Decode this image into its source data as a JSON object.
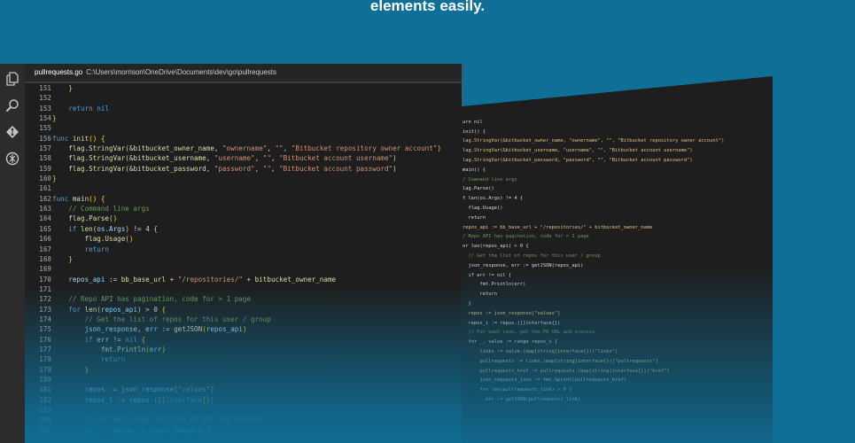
{
  "headline": "elements easily.",
  "activity_icons": [
    "files-icon",
    "search-icon",
    "git-icon",
    "debug-icon"
  ],
  "editor": {
    "tab_name": "pullrequests.go",
    "tab_path": "C:\\Users\\morrison\\OneDrive\\Documents\\dev\\go\\pullrequests",
    "lines": [
      {
        "n": "151",
        "t": [
          [
            "br",
            "    }"
          ]
        ]
      },
      {
        "n": "152",
        "t": []
      },
      {
        "n": "153",
        "t": [
          [
            "kw",
            "    return "
          ],
          [
            "kw",
            "nil"
          ]
        ]
      },
      {
        "n": "154",
        "t": [
          [
            "br",
            "}"
          ]
        ]
      },
      {
        "n": "155",
        "t": []
      },
      {
        "n": "156",
        "t": [
          [
            "kw",
            "func "
          ],
          [
            "fn",
            "init"
          ],
          [
            "br",
            "() {"
          ]
        ]
      },
      {
        "n": "157",
        "t": [
          [
            "fn",
            "    flag.StringVar"
          ],
          [
            "br",
            "("
          ],
          [
            "op",
            "&"
          ],
          [
            "fn",
            "bitbucket_owner_name"
          ],
          [
            "op",
            ", "
          ],
          [
            "str",
            "\"ownername\""
          ],
          [
            "op",
            ", "
          ],
          [
            "str",
            "\"\""
          ],
          [
            "op",
            ", "
          ],
          [
            "str",
            "\"Bitbucket repository owner account\""
          ],
          [
            "br",
            ")"
          ]
        ]
      },
      {
        "n": "158",
        "t": [
          [
            "fn",
            "    flag.StringVar"
          ],
          [
            "br",
            "("
          ],
          [
            "op",
            "&"
          ],
          [
            "fn",
            "bitbucket_username"
          ],
          [
            "op",
            ", "
          ],
          [
            "str",
            "\"username\""
          ],
          [
            "op",
            ", "
          ],
          [
            "str",
            "\"\""
          ],
          [
            "op",
            ", "
          ],
          [
            "str",
            "\"Bitbucket account username\""
          ],
          [
            "br",
            ")"
          ]
        ]
      },
      {
        "n": "159",
        "t": [
          [
            "fn",
            "    flag.StringVar"
          ],
          [
            "br",
            "("
          ],
          [
            "op",
            "&"
          ],
          [
            "fn",
            "bitbucket_password"
          ],
          [
            "op",
            ", "
          ],
          [
            "str",
            "\"password\""
          ],
          [
            "op",
            ", "
          ],
          [
            "str",
            "\"\""
          ],
          [
            "op",
            ", "
          ],
          [
            "str",
            "\"Bitbucket account password\""
          ],
          [
            "br",
            ")"
          ]
        ]
      },
      {
        "n": "160",
        "t": [
          [
            "br",
            "}"
          ]
        ]
      },
      {
        "n": "161",
        "t": []
      },
      {
        "n": "162",
        "t": [
          [
            "kw",
            "func "
          ],
          [
            "fn",
            "main"
          ],
          [
            "br",
            "() {"
          ]
        ]
      },
      {
        "n": "163",
        "t": [
          [
            "cm",
            "    // Command line args"
          ]
        ]
      },
      {
        "n": "164",
        "t": [
          [
            "fn",
            "    flag.Parse"
          ],
          [
            "br",
            "()"
          ]
        ]
      },
      {
        "n": "165",
        "t": [
          [
            "kw",
            "    if "
          ],
          [
            "fn",
            "len"
          ],
          [
            "br",
            "("
          ],
          [
            "var",
            "os.Args"
          ],
          [
            "br",
            ")"
          ],
          [
            "op",
            " != "
          ],
          [
            "plain",
            "4 "
          ],
          [
            "br",
            "{"
          ]
        ]
      },
      {
        "n": "166",
        "t": [
          [
            "fn",
            "        flag.Usage"
          ],
          [
            "br",
            "()"
          ]
        ]
      },
      {
        "n": "167",
        "t": [
          [
            "kw",
            "        return"
          ]
        ]
      },
      {
        "n": "168",
        "t": [
          [
            "br",
            "    }"
          ]
        ]
      },
      {
        "n": "169",
        "t": []
      },
      {
        "n": "170",
        "t": [
          [
            "var",
            "    repos_api "
          ],
          [
            "op",
            ":= "
          ],
          [
            "fn",
            "bb_base_url "
          ],
          [
            "op",
            "+ "
          ],
          [
            "str",
            "\"/repositories/\" "
          ],
          [
            "op",
            "+ "
          ],
          [
            "fn",
            "bitbucket_owner_name"
          ]
        ]
      },
      {
        "n": "171",
        "t": []
      },
      {
        "n": "172",
        "t": [
          [
            "cm",
            "    // Repo API has pagination, code for > 1 page"
          ]
        ]
      },
      {
        "n": "173",
        "t": [
          [
            "kw",
            "    for "
          ],
          [
            "fn",
            "len"
          ],
          [
            "br",
            "("
          ],
          [
            "var",
            "repos_api"
          ],
          [
            "br",
            ")"
          ],
          [
            "op",
            " > "
          ],
          [
            "plain",
            "0 "
          ],
          [
            "br",
            "{"
          ]
        ]
      },
      {
        "n": "174",
        "t": [
          [
            "cm",
            "        // Get the list of repos for this user / group"
          ]
        ]
      },
      {
        "n": "175",
        "t": [
          [
            "var",
            "        json_response"
          ],
          [
            "op",
            ", "
          ],
          [
            "var",
            "err "
          ],
          [
            "op",
            ":= "
          ],
          [
            "fn",
            "getJSON"
          ],
          [
            "br",
            "("
          ],
          [
            "var",
            "repos_api"
          ],
          [
            "br",
            ")"
          ]
        ]
      },
      {
        "n": "176",
        "t": [
          [
            "kw",
            "        if "
          ],
          [
            "var",
            "err "
          ],
          [
            "op",
            "!= "
          ],
          [
            "kw",
            "nil "
          ],
          [
            "br",
            "{"
          ]
        ]
      },
      {
        "n": "177",
        "t": [
          [
            "fn",
            "            fmt.Println"
          ],
          [
            "br",
            "("
          ],
          [
            "var",
            "err"
          ],
          [
            "br",
            ")"
          ]
        ]
      },
      {
        "n": "178",
        "t": [
          [
            "kw",
            "            return"
          ]
        ]
      },
      {
        "n": "179",
        "t": [
          [
            "br",
            "        }"
          ]
        ]
      },
      {
        "n": "180",
        "t": []
      },
      {
        "n": "181",
        "t": [
          [
            "var",
            "        repos "
          ],
          [
            "op",
            ":= "
          ],
          [
            "var",
            "json_response"
          ],
          [
            "br",
            "["
          ],
          [
            "str",
            "\"values\""
          ],
          [
            "br",
            "]"
          ]
        ]
      },
      {
        "n": "182",
        "t": [
          [
            "var",
            "        repos_i "
          ],
          [
            "op",
            ":= "
          ],
          [
            "var",
            "repos."
          ],
          [
            "br",
            "("
          ],
          [
            "op",
            "[]"
          ],
          [
            "kw",
            "interface"
          ],
          [
            "br",
            "{})"
          ]
        ]
      },
      {
        "n": "183",
        "t": []
      },
      {
        "n": "184",
        "t": [
          [
            "cm",
            "        // For each repo, get the PR URL and process"
          ]
        ]
      },
      {
        "n": "185",
        "t": [
          [
            "kw",
            "        for "
          ],
          [
            "var",
            "_, value "
          ],
          [
            "op",
            ":= "
          ],
          [
            "kw",
            "range "
          ],
          [
            "var",
            "repos_i "
          ],
          [
            "br",
            "{"
          ]
        ]
      }
    ]
  },
  "back_editor_lines": [
    "        ",
    "urn nil",
    "",
    "init() {",
    "lag.StringVar(&bitbucket_owner_name, \"ownername\", \"\", \"Bitbucket repository owner account\")",
    "lag.StringVar(&bitbucket_username, \"username\", \"\", \"Bitbucket account username\")",
    "lag.StringVar(&bitbucket_password, \"password\", \"\", \"Bitbucket account password\")",
    "",
    "",
    "main() {",
    "/ Command line args",
    "lag.Parse()",
    "f len(os.Args) != 4 {",
    "  flag.Usage()",
    "  return",
    "",
    "",
    "repos_api := bb_base_url + \"/repositories/\" + bitbucket_owner_name",
    "",
    "/ Repo API has pagination, code for > 1 page",
    "or len(repos_api) > 0 {",
    "  // Get the list of repos for this user / group",
    "  json_response, err := getJSON(repos_api)",
    "  if err != nil {",
    "      fmt.Println(err)",
    "      return",
    "  }",
    "",
    "  repos := json_response[\"values\"]",
    "  repos_i := repos.([]interface{})",
    "",
    "  // For each repo, get the PR URL and process",
    "  for _, value := range repos_i {",
    "      links := value.(map[string]interface{})[\"links\"]",
    "      pullrequests := links.(map[string]interface{})[\"pullrequests\"]",
    "      pullrequests_href := pullrequests.(map[string]interface{})[\"href\"]",
    "",
    "      json_requests_json := fmt.Sprint(pullrequests_href)",
    "      for len(pullrequests_link) > 0 {",
    "",
    "        err := getJSON(pullrequests_link)"
  ]
}
